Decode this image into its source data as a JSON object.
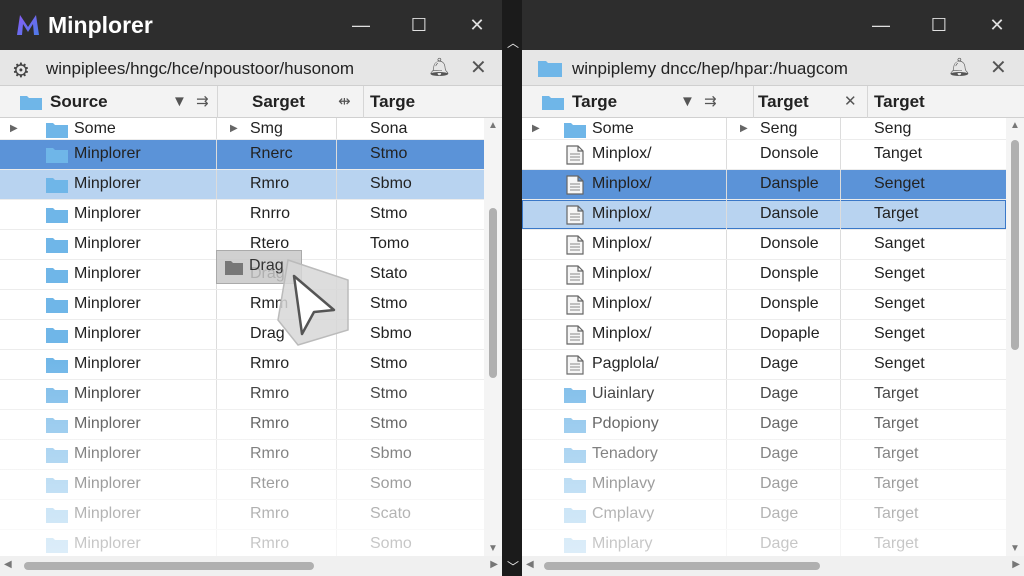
{
  "app": {
    "title": "Minplorer"
  },
  "left": {
    "path": "winpiplees/hngc/hce/npoustoor/husonom",
    "columns": [
      "Source",
      "Sarget",
      "Targe"
    ],
    "rows": [
      {
        "name": "Some",
        "c2": "Smg",
        "c3": "Sona",
        "icon": "folder-icon",
        "state": "header"
      },
      {
        "name": "Minplorer",
        "c2": "Rnerc",
        "c3": "Stmo",
        "icon": "folder-icon",
        "state": "sel-strong"
      },
      {
        "name": "Minplorer",
        "c2": "Rmro",
        "c3": "Sbmo",
        "icon": "folder-icon",
        "state": "sel-light"
      },
      {
        "name": "Minplorer",
        "c2": "Rnrro",
        "c3": "Stmo",
        "icon": "folder-icon",
        "state": ""
      },
      {
        "name": "Minplorer",
        "c2": "Rtero",
        "c3": "Tomo",
        "icon": "folder-icon",
        "state": ""
      },
      {
        "name": "Minplorer",
        "c2": "Drag",
        "c3": "Stato",
        "icon": "folder-icon",
        "state": ""
      },
      {
        "name": "Minplorer",
        "c2": "Rmm",
        "c3": "Stmo",
        "icon": "folder-icon",
        "state": ""
      },
      {
        "name": "Minplorer",
        "c2": "Drag",
        "c3": "Sbmo",
        "icon": "folder-icon",
        "state": ""
      },
      {
        "name": "Minplorer",
        "c2": "Rmro",
        "c3": "Stmo",
        "icon": "folder-icon",
        "state": ""
      },
      {
        "name": "Minplorer",
        "c2": "Rmro",
        "c3": "Stmo",
        "icon": "folder-icon",
        "state": ""
      },
      {
        "name": "Minplorer",
        "c2": "Rmro",
        "c3": "Stmo",
        "icon": "folder-icon",
        "state": ""
      },
      {
        "name": "Minplorer",
        "c2": "Rmro",
        "c3": "Sbmo",
        "icon": "folder-icon",
        "state": ""
      },
      {
        "name": "Minplorer",
        "c2": "Rtero",
        "c3": "Somo",
        "icon": "folder-icon",
        "state": ""
      },
      {
        "name": "Minplorer",
        "c2": "Rmro",
        "c3": "Scato",
        "icon": "folder-icon",
        "state": ""
      },
      {
        "name": "Minplorer",
        "c2": "Rmro",
        "c3": "Somo",
        "icon": "folder-icon",
        "state": ""
      }
    ]
  },
  "right": {
    "path": "winpiplemy dncc/hep/hpar:/huagcom",
    "columns": [
      "Targe",
      "Target",
      "Target"
    ],
    "rows": [
      {
        "name": "Some",
        "c2": "Seng",
        "c3": "Seng",
        "icon": "folder-icon",
        "state": "header"
      },
      {
        "name": "Minplox/",
        "c2": "Donsole",
        "c3": "Tanget",
        "icon": "document-icon",
        "state": ""
      },
      {
        "name": "Minplox/",
        "c2": "Dansple",
        "c3": "Senget",
        "icon": "document-icon",
        "state": "sel-strong"
      },
      {
        "name": "Minplox/",
        "c2": "Dansole",
        "c3": "Target",
        "icon": "document-icon",
        "state": "sel-light"
      },
      {
        "name": "Minplox/",
        "c2": "Donsole",
        "c3": "Sanget",
        "icon": "document-icon",
        "state": ""
      },
      {
        "name": "Minplox/",
        "c2": "Donsple",
        "c3": "Senget",
        "icon": "document-icon",
        "state": ""
      },
      {
        "name": "Minplox/",
        "c2": "Donsple",
        "c3": "Senget",
        "icon": "document-icon",
        "state": ""
      },
      {
        "name": "Minplox/",
        "c2": "Dopaple",
        "c3": "Senget",
        "icon": "document-icon",
        "state": ""
      },
      {
        "name": "Pagplola/",
        "c2": "Dage",
        "c3": "Senget",
        "icon": "document-icon",
        "state": ""
      },
      {
        "name": "Uiainlary",
        "c2": "Dage",
        "c3": "Target",
        "icon": "folder-icon",
        "state": ""
      },
      {
        "name": "Pdopiony",
        "c2": "Dage",
        "c3": "Target",
        "icon": "folder-icon",
        "state": ""
      },
      {
        "name": "Tenadory",
        "c2": "Dage",
        "c3": "Target",
        "icon": "folder-icon",
        "state": ""
      },
      {
        "name": "Minplavy",
        "c2": "Dage",
        "c3": "Target",
        "icon": "folder-icon",
        "state": ""
      },
      {
        "name": "Cmplavy",
        "c2": "Dage",
        "c3": "Target",
        "icon": "folder-icon",
        "state": ""
      },
      {
        "name": "Minplary",
        "c2": "Dage",
        "c3": "Target",
        "icon": "folder-icon",
        "state": ""
      }
    ]
  },
  "drag": {
    "label": "Drag"
  },
  "colors": {
    "accent": "#5b93d8",
    "selection_light": "#b8d3f0",
    "folder": "#6fb6e8",
    "titlebar": "#2d2d2d"
  }
}
